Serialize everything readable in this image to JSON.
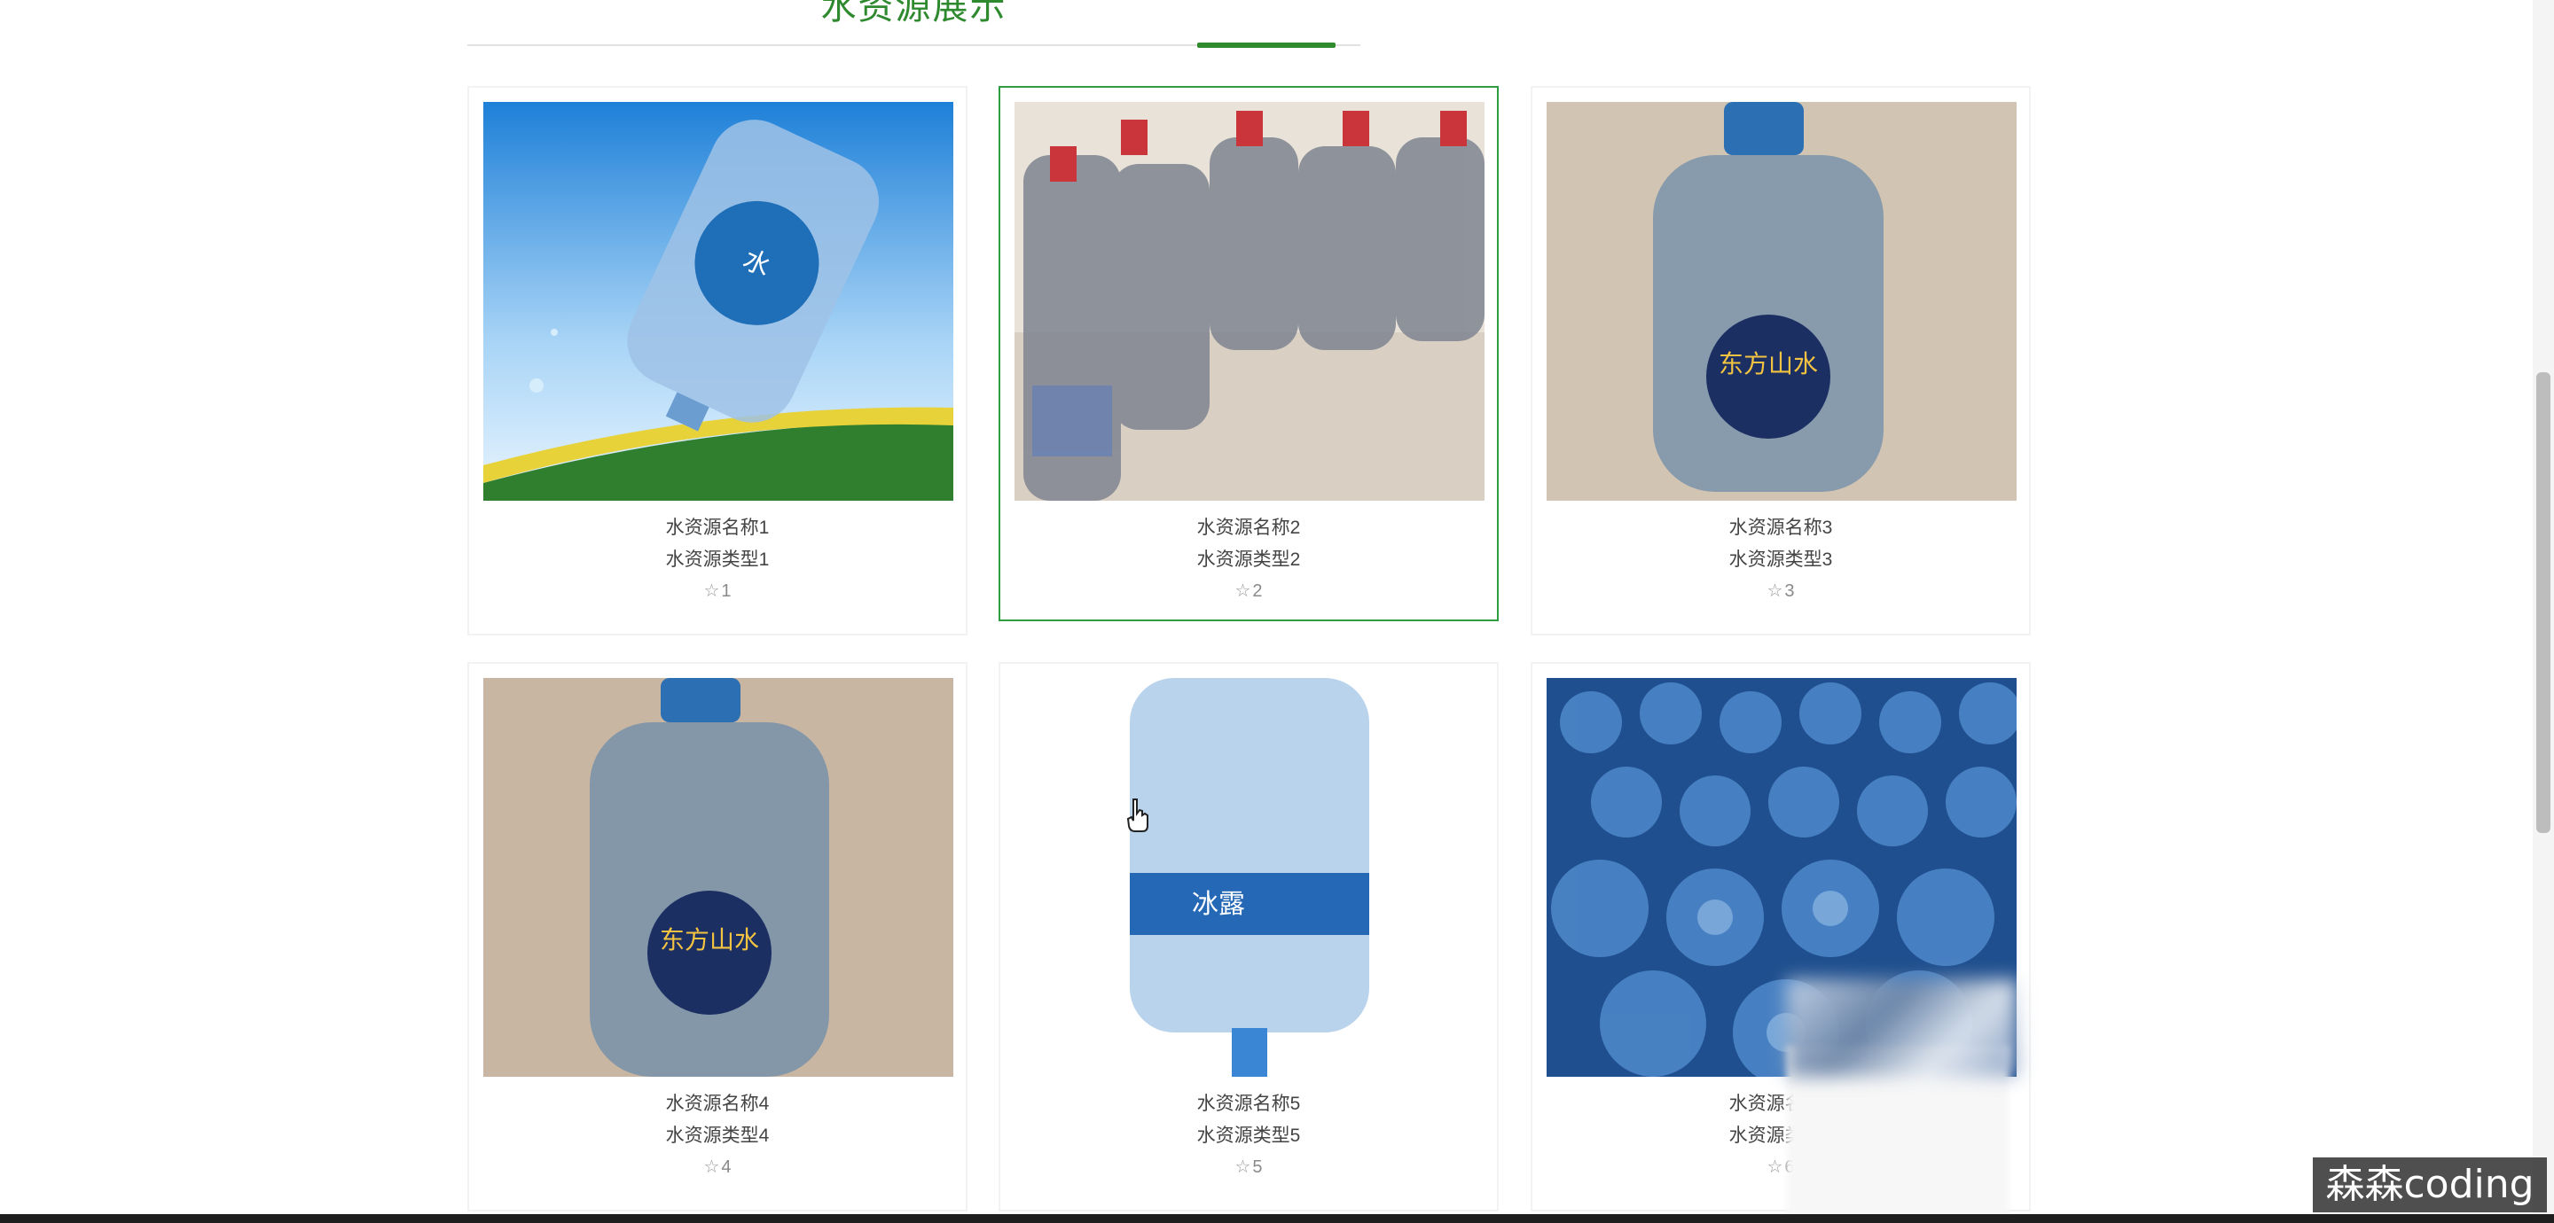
{
  "section": {
    "title": "水资源展示"
  },
  "cards": [
    {
      "name": "水资源名称1",
      "type": "水资源类型1",
      "favorites": "1",
      "image": "rotated-water-bottle-blue-sky"
    },
    {
      "name": "水资源名称2",
      "type": "水资源类型2",
      "favorites": "2",
      "image": "stack-of-bottles-with-red-caps"
    },
    {
      "name": "水资源名称3",
      "type": "水资源类型3",
      "favorites": "3",
      "image": "small-bottle-on-wood-floor"
    },
    {
      "name": "水资源名称4",
      "type": "水资源类型4",
      "favorites": "4",
      "image": "small-bottle-wood-wall"
    },
    {
      "name": "水资源名称5",
      "type": "水资源类型5",
      "favorites": "5",
      "image": "large-bottle-with-label"
    },
    {
      "name": "水资源名称6",
      "type": "水资源类型6",
      "favorites": "6",
      "image": "many-blue-bottles-pile"
    }
  ],
  "watermark": "森森coding",
  "colors": {
    "accent": "#2e8b2e",
    "active_border": "#2e9e3e"
  }
}
